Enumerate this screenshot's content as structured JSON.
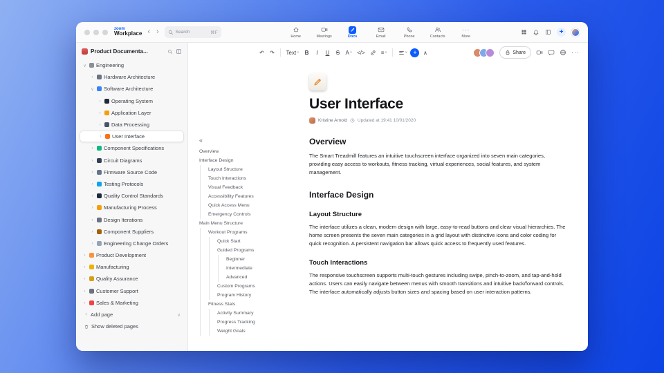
{
  "accent_color": "#0b5cff",
  "glyphs": {
    "caret_down": "∨",
    "caret_up": "∧",
    "chevron_right": "›",
    "collapse_left": "«",
    "more_dots": "···",
    "plus": "+"
  },
  "titlebar": {
    "logo": {
      "line1": "zoom",
      "line2": "Workplace"
    },
    "back": "‹",
    "forward": "›",
    "search": {
      "placeholder": "Search",
      "shortcut": "⌘F"
    },
    "tabs": [
      {
        "label": "Home",
        "icon": "home-icon",
        "svg": "home"
      },
      {
        "label": "Meetings",
        "icon": "meetings-icon",
        "svg": "camera"
      },
      {
        "label": "Docs",
        "icon": "docs-icon",
        "svg": "pencil",
        "chip": true,
        "active": true
      },
      {
        "label": "Email",
        "icon": "email-icon",
        "svg": "mail"
      },
      {
        "label": "Phone",
        "icon": "phone-icon",
        "svg": "phone"
      },
      {
        "label": "Contacts",
        "icon": "contacts-icon",
        "svg": "contacts"
      },
      {
        "label": "More",
        "icon": "more-icon",
        "glyph": "···"
      }
    ],
    "right_icons": [
      {
        "name": "apps-icon",
        "svg": "grid"
      },
      {
        "name": "notifications-icon",
        "svg": "bell"
      },
      {
        "name": "side-panel-icon",
        "svg": "panel"
      }
    ],
    "new_button_glyph": "+"
  },
  "sidebar": {
    "title": "Product Documenta...",
    "tree": [
      {
        "label": "Engineering",
        "level": 0,
        "icon": "gear-icon",
        "color": "#8a8f98",
        "chevron": "down"
      },
      {
        "label": "Hardware Architecture",
        "level": 1,
        "icon": "wrench-icon",
        "color": "#6b7280",
        "chevron": "right"
      },
      {
        "label": "Software Architecture",
        "level": 1,
        "icon": "blocks-icon",
        "color": "#3b82f6",
        "chevron": "down"
      },
      {
        "label": "Operating System",
        "level": 2,
        "icon": "device-icon",
        "color": "#1f2937",
        "chevron": "right"
      },
      {
        "label": "Application Layer",
        "level": 2,
        "icon": "folder-icon",
        "color": "#f59e0b",
        "chevron": "right"
      },
      {
        "label": "Data Processing",
        "level": 2,
        "icon": "chart-icon",
        "color": "#475569",
        "chevron": "right"
      },
      {
        "label": "User Interface",
        "level": 2,
        "icon": "palette-icon",
        "color": "#f97316",
        "chevron": "right",
        "selected": true
      },
      {
        "label": "Component Specifications",
        "level": 1,
        "icon": "clipboard-icon",
        "color": "#10b981",
        "chevron": "right"
      },
      {
        "label": "Circuit Diagrams",
        "level": 1,
        "icon": "circuit-icon",
        "color": "#334155",
        "chevron": "right"
      },
      {
        "label": "Firmware Source Code",
        "level": 1,
        "icon": "disk-icon",
        "color": "#64748b",
        "chevron": "right"
      },
      {
        "label": "Testing Protocols",
        "level": 1,
        "icon": "flask-icon",
        "color": "#0ea5e9",
        "chevron": "right"
      },
      {
        "label": "Quality Control Standards",
        "level": 1,
        "icon": "shield-icon",
        "color": "#1e293b",
        "chevron": "right"
      },
      {
        "label": "Manufacturing Process",
        "level": 1,
        "icon": "factory-icon",
        "color": "#f59e0b",
        "chevron": "right"
      },
      {
        "label": "Design Iterations",
        "level": 1,
        "icon": "cycle-icon",
        "color": "#6b7280",
        "chevron": "right"
      },
      {
        "label": "Component Suppliers",
        "level": 1,
        "icon": "box-icon",
        "color": "#a16207",
        "chevron": "right"
      },
      {
        "label": "Engineering Change Orders",
        "level": 1,
        "icon": "document-icon",
        "color": "#94a3b8",
        "chevron": "right"
      },
      {
        "label": "Product Development",
        "level": 0,
        "icon": "rocket-icon",
        "color": "#fb923c",
        "chevron": "right"
      },
      {
        "label": "Manufacturing",
        "level": 0,
        "icon": "tools-icon",
        "color": "#eab308",
        "chevron": "right"
      },
      {
        "label": "Quality Assurance",
        "level": 0,
        "icon": "medal-icon",
        "color": "#d4a017",
        "chevron": "right"
      },
      {
        "label": "Customer Support",
        "level": 0,
        "icon": "chat-icon",
        "color": "#6b7280",
        "chevron": "right"
      },
      {
        "label": "Sales & Marketing",
        "level": 0,
        "icon": "megaphone-icon",
        "color": "#ef4444",
        "chevron": "right"
      }
    ],
    "add_page_label": "Add page",
    "show_deleted_label": "Show deleted pages"
  },
  "toc": {
    "collapse_glyph": "«",
    "items": [
      {
        "label": "Overview",
        "level": 0
      },
      {
        "label": "Interface Design",
        "level": 0
      },
      {
        "label": "Layout Structure",
        "level": 1
      },
      {
        "label": "Touch Interactions",
        "level": 1
      },
      {
        "label": "Visual Feedback",
        "level": 1
      },
      {
        "label": "Accessibility Features",
        "level": 1
      },
      {
        "label": "Quick Access Menu",
        "level": 1
      },
      {
        "label": "Emergency Controls",
        "level": 1
      },
      {
        "label": "Main Menu Structure",
        "level": 0
      },
      {
        "label": "Workout Programs",
        "level": 1
      },
      {
        "label": "Quick Start",
        "level": 2
      },
      {
        "label": "Guided Programs",
        "level": 2
      },
      {
        "label": "Beginner",
        "level": 3
      },
      {
        "label": "Intermediate",
        "level": 3
      },
      {
        "label": "Advanced",
        "level": 3
      },
      {
        "label": "Custom Programs",
        "level": 2
      },
      {
        "label": "Program History",
        "level": 2
      },
      {
        "label": "Fitness Stats",
        "level": 1
      },
      {
        "label": "Activity Summary",
        "level": 2
      },
      {
        "label": "Progress Tracking",
        "level": 2
      },
      {
        "label": "Weight Goals",
        "level": 2
      }
    ]
  },
  "doc_toolbar": {
    "left_items": [
      {
        "name": "undo-button",
        "glyph": "↶"
      },
      {
        "name": "redo-button",
        "glyph": "↷"
      },
      {
        "name": "divider"
      },
      {
        "name": "text-style-select",
        "label": "Text",
        "caret": true
      },
      {
        "name": "bold-button",
        "glyph": "B",
        "style": "b"
      },
      {
        "name": "italic-button",
        "glyph": "I",
        "style": "i"
      },
      {
        "name": "underline-button",
        "glyph": "U",
        "style": "u"
      },
      {
        "name": "strikethrough-button",
        "glyph": "S",
        "style": "s"
      },
      {
        "name": "text-color-button",
        "glyph": "A",
        "caret": true
      },
      {
        "name": "code-button",
        "glyph": "</>"
      },
      {
        "name": "link-button",
        "icon": "link"
      },
      {
        "name": "list-button",
        "glyph": "≡",
        "caret": true
      },
      {
        "name": "divider"
      },
      {
        "name": "align-button",
        "icon": "align",
        "caret": true
      },
      {
        "name": "insert-button",
        "glyph": "+",
        "accent": true
      },
      {
        "name": "collapse-toolbar-button",
        "glyph": "∧"
      }
    ],
    "collaborators": [
      {
        "name": "collaborator-avatar",
        "color": "#d98a6a"
      },
      {
        "name": "collaborator-avatar",
        "color": "#7fa8e8"
      },
      {
        "name": "collaborator-avatar",
        "color": "#b98ad9"
      }
    ],
    "share_label": "Share",
    "right_items": [
      {
        "name": "video-button",
        "icon": "camera"
      },
      {
        "name": "comment-button",
        "icon": "bubble"
      },
      {
        "name": "globe-button",
        "icon": "globe"
      },
      {
        "name": "more-button",
        "glyph": "···"
      }
    ]
  },
  "document": {
    "title": "User Interface",
    "author": "Kristine Arnold",
    "updated": "Updated at 19:41 10/01/2020",
    "sections": [
      {
        "type": "h2",
        "text": "Overview"
      },
      {
        "type": "p",
        "text": "The Smart Treadmill features an intuitive touchscreen interface organized into seven main categories, providing easy access to workouts, fitness tracking, virtual experiences, social features, and system management."
      },
      {
        "type": "h2",
        "text": "Interface Design"
      },
      {
        "type": "h3",
        "text": "Layout Structure"
      },
      {
        "type": "p",
        "text": "The interface utilizes a clean, modern design with large, easy-to-read buttons and clear visual hierarchies. The home screen presents the seven main categories in a grid layout with distinctive icons and color coding for quick recognition. A persistent navigation bar allows quick access to frequently used features."
      },
      {
        "type": "h3",
        "text": "Touch Interactions"
      },
      {
        "type": "p",
        "text": "The responsive touchscreen supports multi-touch gestures including swipe, pinch-to-zoom, and tap-and-hold actions. Users can easily navigate between menus with smooth transitions and intuitive back/forward controls. The interface automatically adjusts button sizes and spacing based on user interaction patterns."
      }
    ]
  }
}
